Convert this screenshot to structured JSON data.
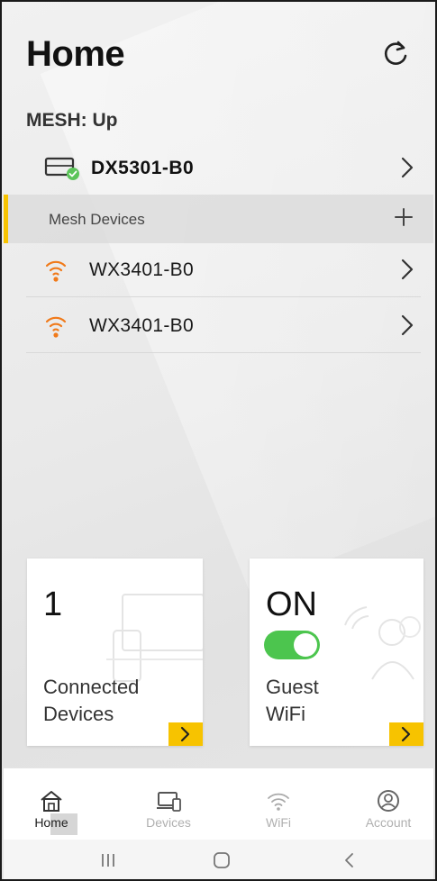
{
  "header": {
    "title": "Home",
    "refresh_icon": "refresh-icon"
  },
  "mesh": {
    "status": "MESH: Up"
  },
  "router": {
    "name": "DX5301-B0",
    "icon": "router-connected-icon"
  },
  "mesh_devices": {
    "label": "Mesh Devices",
    "add_icon": "plus-icon",
    "items": [
      {
        "name": "WX3401-B0",
        "icon": "wifi-signal-icon"
      },
      {
        "name": "WX3401-B0",
        "icon": "wifi-signal-icon"
      }
    ]
  },
  "cards": {
    "connected": {
      "count": "1",
      "label_line1": "Connected",
      "label_line2": "Devices"
    },
    "guest": {
      "state": "ON",
      "toggle_on": true,
      "label_line1": "Guest",
      "label_line2": "WiFi"
    }
  },
  "tabs": [
    {
      "label": "Home",
      "icon": "home-icon",
      "active": true
    },
    {
      "label": "Devices",
      "icon": "devices-icon",
      "active": false
    },
    {
      "label": "WiFi",
      "icon": "wifi-icon",
      "active": false
    },
    {
      "label": "Account",
      "icon": "account-icon",
      "active": false
    }
  ],
  "colors": {
    "accent": "#f7c300",
    "toggle_on": "#4cc54e",
    "wifi_orange": "#f07a1a",
    "status_green": "#5cc45a"
  }
}
